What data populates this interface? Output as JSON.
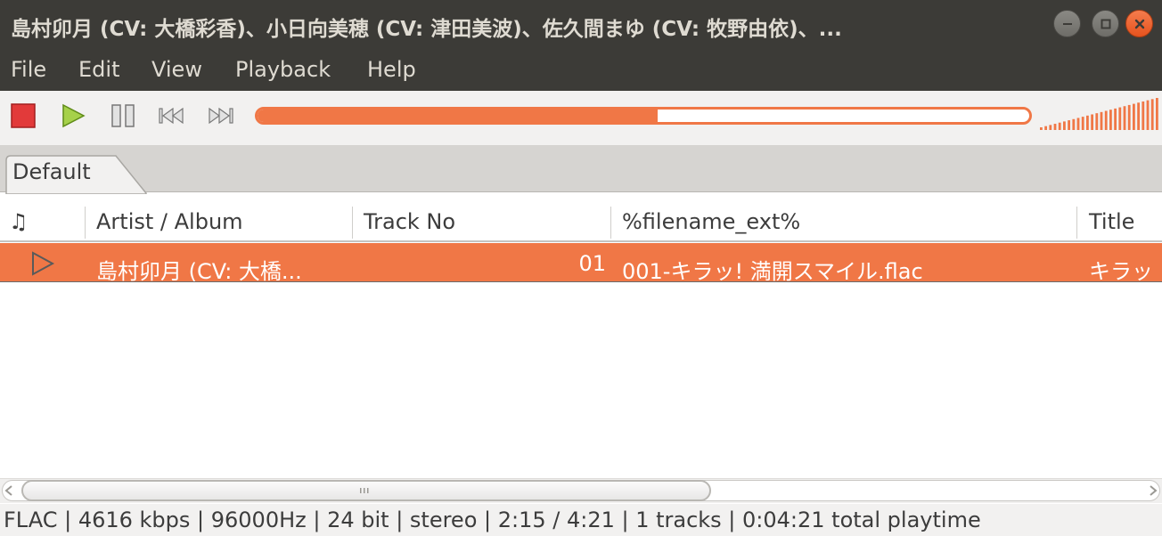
{
  "window": {
    "title": "島村卯月 (CV: 大橋彩香)、小日向美穂 (CV: 津田美波)、佐久間まゆ (CV: 牧野由依)、...",
    "controls": {
      "minimize_icon": "minimize-icon",
      "maximize_icon": "maximize-icon",
      "close_icon": "close-icon"
    }
  },
  "menu": {
    "items": [
      "File",
      "Edit",
      "View",
      "Playback",
      "Help"
    ]
  },
  "toolbar": {
    "buttons": [
      "stop-icon",
      "play-icon",
      "pause-icon",
      "previous-icon",
      "next-icon"
    ],
    "seek_progress": 0.518,
    "volume_level": 1.0,
    "colors": {
      "accent": "#f07746",
      "stop": "#e23a3a",
      "play": "#86b52a"
    }
  },
  "tabs": [
    {
      "label": "Default",
      "active": true
    }
  ],
  "playlist": {
    "columns": [
      "♫",
      "Artist / Album",
      "Track No",
      "%filename_ext%",
      "Title"
    ],
    "rows": [
      {
        "playing_icon": "play-indicator-icon",
        "artist_album": "島村卯月 (CV: 大橋...",
        "track_no": "01",
        "filename": "001-キラッ! 満開スマイル.flac",
        "title": "キラッ"
      }
    ]
  },
  "statusbar": {
    "text": "FLAC | 4616 kbps | 96000Hz | 24 bit | stereo | 2:15 / 4:21 | 1 tracks | 0:04:21 total playtime"
  }
}
